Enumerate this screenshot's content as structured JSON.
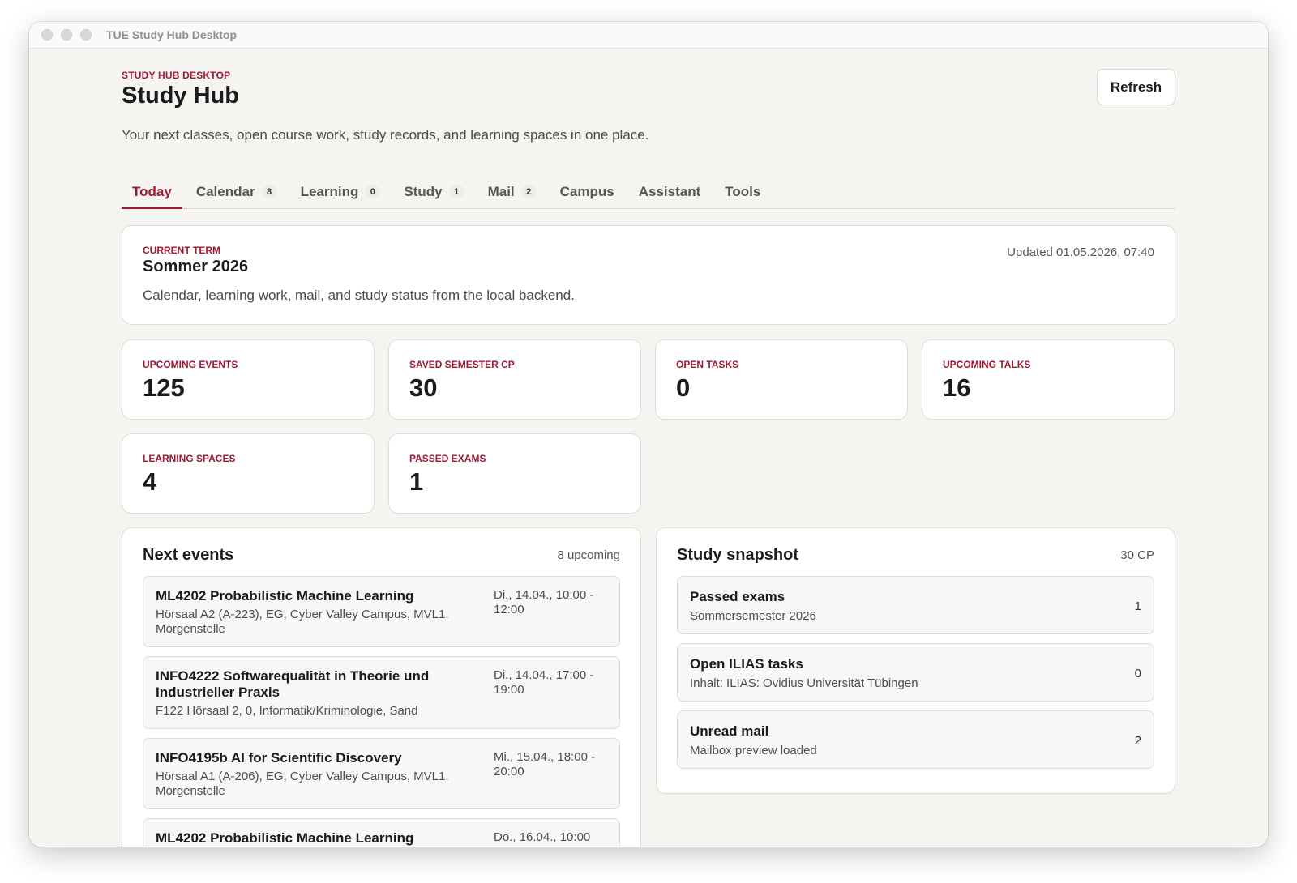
{
  "window": {
    "title": "TUE Study Hub Desktop"
  },
  "header": {
    "eyebrow": "STUDY HUB DESKTOP",
    "title": "Study Hub",
    "subtitle": "Your next classes, open course work, study records, and learning spaces in one place.",
    "refresh_label": "Refresh"
  },
  "tabs": [
    {
      "label": "Today",
      "count": null,
      "active": true
    },
    {
      "label": "Calendar",
      "count": "8"
    },
    {
      "label": "Learning",
      "count": "0"
    },
    {
      "label": "Study",
      "count": "1"
    },
    {
      "label": "Mail",
      "count": "2"
    },
    {
      "label": "Campus",
      "count": null
    },
    {
      "label": "Assistant",
      "count": null
    },
    {
      "label": "Tools",
      "count": null
    }
  ],
  "term": {
    "label": "CURRENT TERM",
    "name": "Sommer 2026",
    "description": "Calendar, learning work, mail, and study status from the local backend.",
    "updated": "Updated 01.05.2026, 07:40"
  },
  "stats": [
    {
      "label": "UPCOMING EVENTS",
      "value": "125"
    },
    {
      "label": "SAVED SEMESTER CP",
      "value": "30"
    },
    {
      "label": "OPEN TASKS",
      "value": "0"
    },
    {
      "label": "UPCOMING TALKS",
      "value": "16"
    },
    {
      "label": "LEARNING SPACES",
      "value": "4"
    },
    {
      "label": "PASSED EXAMS",
      "value": "1"
    }
  ],
  "events_panel": {
    "title": "Next events",
    "meta": "8 upcoming",
    "events": [
      {
        "title": "ML4202 Probabilistic Machine Learning",
        "location": "Hörsaal A2 (A-223), EG, Cyber Valley Campus, MVL1, Morgenstelle",
        "time": "Di., 14.04., 10:00 - 12:00"
      },
      {
        "title": "INFO4222 Softwarequalität in Theorie und Industrieller Praxis",
        "location": "F122 Hörsaal 2, 0, Informatik/Kriminologie, Sand",
        "time": "Di., 14.04., 17:00 - 19:00"
      },
      {
        "title": "INFO4195b AI for Scientific Discovery",
        "location": "Hörsaal A1 (A-206), EG, Cyber Valley Campus, MVL1, Morgenstelle",
        "time": "Mi., 15.04., 18:00 - 20:00"
      },
      {
        "title": "ML4202 Probabilistic Machine Learning",
        "location": "",
        "time": "Do., 16.04., 10:00"
      }
    ]
  },
  "snapshot_panel": {
    "title": "Study snapshot",
    "meta": "30 CP",
    "items": [
      {
        "title": "Passed exams",
        "subtitle": "Sommersemester 2026",
        "value": "1"
      },
      {
        "title": "Open ILIAS tasks",
        "subtitle": "Inhalt: ILIAS: Ovidius Universität Tübingen",
        "value": "0"
      },
      {
        "title": "Unread mail",
        "subtitle": "Mailbox preview loaded",
        "value": "2"
      }
    ]
  },
  "colors": {
    "accent": "#a01933",
    "background": "#f5f4f1",
    "card": "#ffffff"
  }
}
